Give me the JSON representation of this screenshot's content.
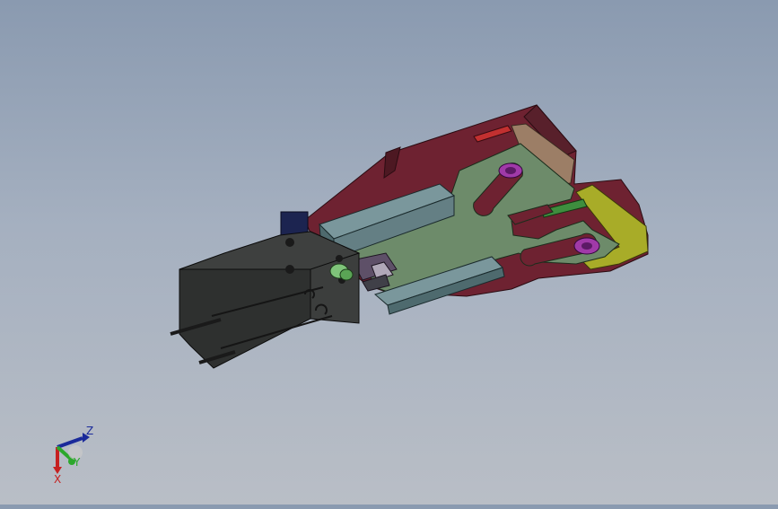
{
  "viewport": {
    "model": "gripper-assembly",
    "background_top": "#8a9ab0",
    "background_bottom": "#b9bec6"
  },
  "triad": {
    "z_label": "Z",
    "y_label": "Y",
    "x_label": "X",
    "z_color": "#1a2a9a",
    "y_color": "#2ca82c",
    "x_color": "#c62020"
  },
  "colors": {
    "frame": "#6e2231",
    "plate": "#6d8b6a",
    "rail": "#647f84",
    "cylinder": "#2e302f",
    "yellow": "#a8ac28",
    "magenta": "#a03aa8",
    "tan": "#9c7e66"
  }
}
